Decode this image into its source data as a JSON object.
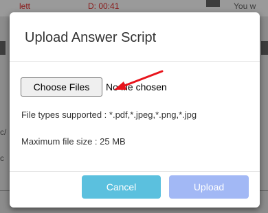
{
  "background": {
    "top_left_text": "lett",
    "top_mid_text": "D: 00:41",
    "top_right_text": "You w",
    "left_fragment_1": "c/",
    "left_fragment_2": "c"
  },
  "modal": {
    "title": "Upload Answer Script",
    "file_input": {
      "button_label": "Choose Files",
      "status_text": "No file chosen"
    },
    "file_types_text": "File types supported : *.pdf,*.jpeg,*.png,*.jpg",
    "max_size_text": "Maximum file size : 25 MB",
    "cancel_label": "Cancel",
    "upload_label": "Upload"
  },
  "colors": {
    "cancel_button": "#5bc0de",
    "upload_button_disabled": "#a2b8f5",
    "annotation_arrow": "#e8141c"
  }
}
